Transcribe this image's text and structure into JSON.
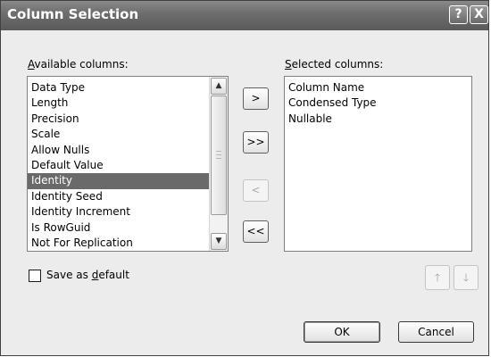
{
  "window": {
    "title": "Column Selection",
    "help_label": "?",
    "close_label": "X"
  },
  "available": {
    "label_accesskey": "A",
    "label_rest": "vailable columns:",
    "items": [
      {
        "label": "Data Type",
        "selected": false
      },
      {
        "label": "Length",
        "selected": false
      },
      {
        "label": "Precision",
        "selected": false
      },
      {
        "label": "Scale",
        "selected": false
      },
      {
        "label": "Allow Nulls",
        "selected": false
      },
      {
        "label": "Default Value",
        "selected": false
      },
      {
        "label": "Identity",
        "selected": true
      },
      {
        "label": "Identity Seed",
        "selected": false
      },
      {
        "label": "Identity Increment",
        "selected": false
      },
      {
        "label": "Is RowGuid",
        "selected": false
      },
      {
        "label": "Not For Replication",
        "selected": false
      }
    ]
  },
  "selected": {
    "label_accesskey": "S",
    "label_rest": "elected columns:",
    "items": [
      {
        "label": "Column Name"
      },
      {
        "label": "Condensed Type"
      },
      {
        "label": "Nullable"
      }
    ]
  },
  "buttons": {
    "add": ">",
    "add_all": ">>",
    "remove": "<",
    "remove_all": "<<",
    "ok": "OK",
    "cancel": "Cancel"
  },
  "save_default": {
    "label_before": "Save as ",
    "label_accesskey": "d",
    "label_after": "efault",
    "checked": false
  },
  "icons": {
    "scroll_up": "▲",
    "scroll_down": "▼",
    "move_up": "🡑",
    "move_down": "🡓"
  },
  "colors": {
    "titlebar": "#6e6e6e",
    "selection": "#6a6a6a",
    "dialog_bg": "#ececec"
  }
}
